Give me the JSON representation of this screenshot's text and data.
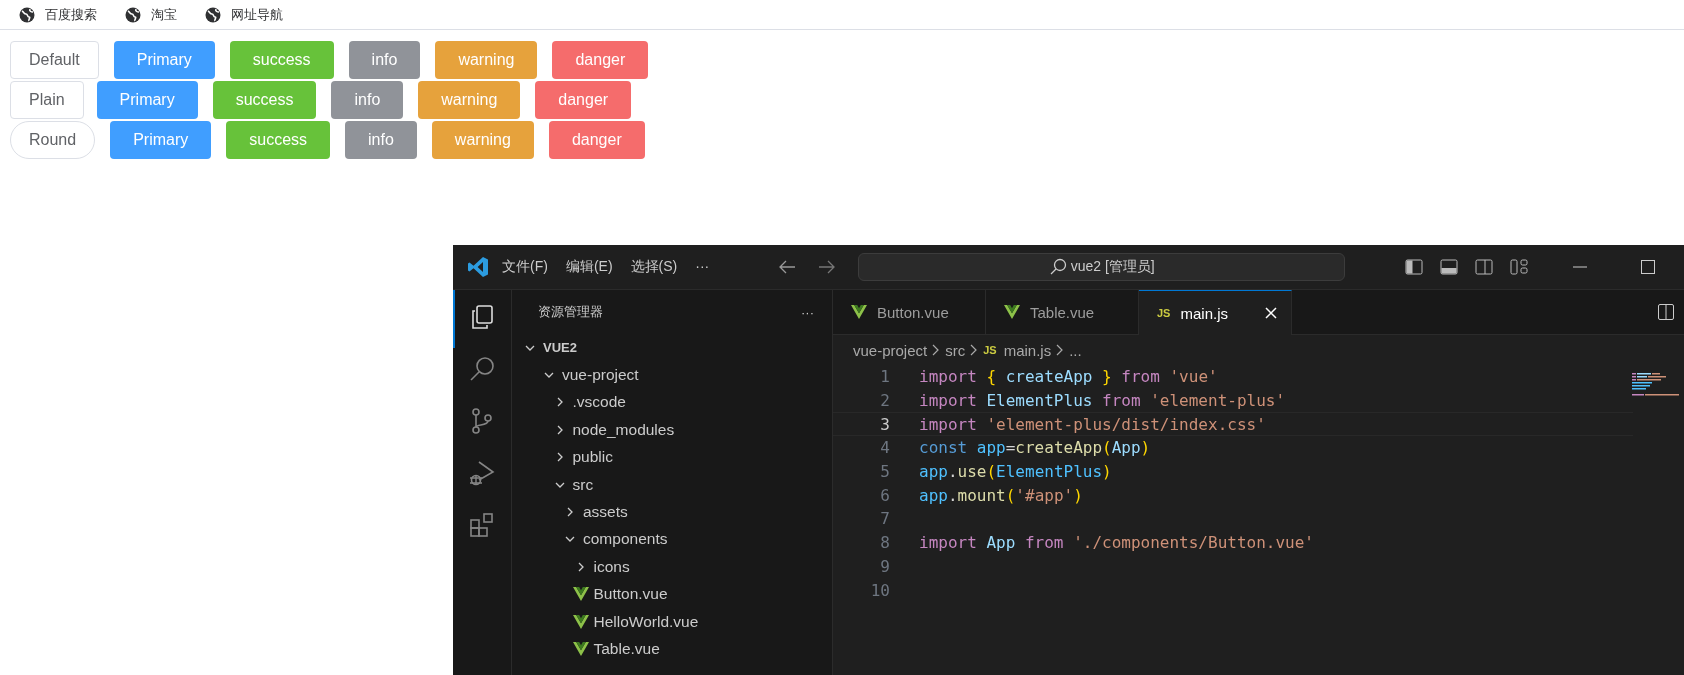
{
  "nav_links": [
    {
      "label": "百度搜索"
    },
    {
      "label": "淘宝"
    },
    {
      "label": "网址导航"
    }
  ],
  "button_rows": [
    {
      "buttons": [
        {
          "label": "Default",
          "kind": "default",
          "round": false
        },
        {
          "label": "Primary",
          "kind": "primary",
          "round": false
        },
        {
          "label": "success",
          "kind": "success",
          "round": false
        },
        {
          "label": "info",
          "kind": "info",
          "round": false
        },
        {
          "label": "warning",
          "kind": "warning",
          "round": false
        },
        {
          "label": "danger",
          "kind": "danger",
          "round": false
        }
      ]
    },
    {
      "buttons": [
        {
          "label": "Plain",
          "kind": "default",
          "round": false
        },
        {
          "label": "Primary",
          "kind": "primary",
          "round": false
        },
        {
          "label": "success",
          "kind": "success",
          "round": false
        },
        {
          "label": "info",
          "kind": "info",
          "round": false
        },
        {
          "label": "warning",
          "kind": "warning",
          "round": false
        },
        {
          "label": "danger",
          "kind": "danger",
          "round": false
        }
      ]
    },
    {
      "buttons": [
        {
          "label": "Round",
          "kind": "default",
          "round": true
        },
        {
          "label": "Primary",
          "kind": "primary",
          "round": false
        },
        {
          "label": "success",
          "kind": "success",
          "round": false
        },
        {
          "label": "info",
          "kind": "info",
          "round": false
        },
        {
          "label": "warning",
          "kind": "warning",
          "round": false
        },
        {
          "label": "danger",
          "kind": "danger",
          "round": false
        }
      ]
    }
  ],
  "vscode": {
    "menu": [
      {
        "label": "文件(F)"
      },
      {
        "label": "编辑(E)"
      },
      {
        "label": "选择(S)"
      },
      {
        "label": "···"
      }
    ],
    "search": "vue2 [管理员]",
    "sidebar": {
      "title": "资源管理器",
      "more": "···"
    },
    "tree": {
      "label": "VUE2",
      "kind": "workspace",
      "expanded": true,
      "children": [
        {
          "label": "vue-project",
          "kind": "folder",
          "expanded": true,
          "children": [
            {
              "label": ".vscode",
              "kind": "folder",
              "expanded": false
            },
            {
              "label": "node_modules",
              "kind": "folder",
              "expanded": false
            },
            {
              "label": "public",
              "kind": "folder",
              "expanded": false
            },
            {
              "label": "src",
              "kind": "folder",
              "expanded": true,
              "children": [
                {
                  "label": "assets",
                  "kind": "folder",
                  "expanded": false
                },
                {
                  "label": "components",
                  "kind": "folder",
                  "expanded": true,
                  "children": [
                    {
                      "label": "icons",
                      "kind": "folder",
                      "expanded": false
                    },
                    {
                      "label": "Button.vue",
                      "kind": "vue"
                    },
                    {
                      "label": "HelloWorld.vue",
                      "kind": "vue"
                    },
                    {
                      "label": "Table.vue",
                      "kind": "vue"
                    }
                  ]
                }
              ]
            }
          ]
        }
      ]
    },
    "tabs": [
      {
        "label": "Button.vue",
        "kind": "vue",
        "selected": false
      },
      {
        "label": "Table.vue",
        "kind": "vue",
        "selected": false
      },
      {
        "label": "main.js",
        "kind": "js",
        "badge": "JS",
        "selected": true
      }
    ],
    "breadcrumb": [
      {
        "label": "vue-project",
        "kind": "folder"
      },
      {
        "label": "src",
        "kind": "folder"
      },
      {
        "label": "main.js",
        "kind": "js",
        "badge": "JS"
      },
      {
        "label": "...",
        "kind": "more"
      }
    ],
    "code": [
      {
        "number": "1",
        "active": false,
        "tokens": [
          {
            "text": "import ",
            "kind": "control"
          },
          {
            "text": "{",
            "kind": "bracket"
          },
          {
            "text": " createApp ",
            "kind": "variable"
          },
          {
            "text": "}",
            "kind": "bracket"
          },
          {
            "text": " from ",
            "kind": "control"
          },
          {
            "text": "'vue'",
            "kind": "string"
          }
        ]
      },
      {
        "number": "2",
        "active": false,
        "tokens": [
          {
            "text": "import ",
            "kind": "control"
          },
          {
            "text": "ElementPlus ",
            "kind": "variable"
          },
          {
            "text": "from ",
            "kind": "control"
          },
          {
            "text": "'element-plus'",
            "kind": "string"
          }
        ]
      },
      {
        "number": "3",
        "active": true,
        "tokens": [
          {
            "text": "import ",
            "kind": "control"
          },
          {
            "text": "'element-plus/dist/index.css'",
            "kind": "string"
          }
        ]
      },
      {
        "number": "4",
        "active": false,
        "tokens": [
          {
            "text": "const ",
            "kind": "storage"
          },
          {
            "text": "app",
            "kind": "constant"
          },
          {
            "text": "=",
            "kind": "plain"
          },
          {
            "text": "createApp",
            "kind": "function"
          },
          {
            "text": "(",
            "kind": "bracket"
          },
          {
            "text": "App",
            "kind": "variable"
          },
          {
            "text": ")",
            "kind": "bracket"
          }
        ]
      },
      {
        "number": "5",
        "active": false,
        "tokens": [
          {
            "text": "app",
            "kind": "constant"
          },
          {
            "text": ".",
            "kind": "plain"
          },
          {
            "text": "use",
            "kind": "function"
          },
          {
            "text": "(",
            "kind": "bracket"
          },
          {
            "text": "ElementPlus",
            "kind": "constant"
          },
          {
            "text": ")",
            "kind": "bracket"
          }
        ]
      },
      {
        "number": "6",
        "active": false,
        "tokens": [
          {
            "text": "app",
            "kind": "constant"
          },
          {
            "text": ".",
            "kind": "plain"
          },
          {
            "text": "mount",
            "kind": "function"
          },
          {
            "text": "(",
            "kind": "bracket"
          },
          {
            "text": "'#app'",
            "kind": "string"
          },
          {
            "text": ")",
            "kind": "bracket"
          }
        ]
      },
      {
        "number": "7",
        "active": false
      },
      {
        "number": "8",
        "active": false,
        "tokens": [
          {
            "text": "import ",
            "kind": "control"
          },
          {
            "text": "App ",
            "kind": "variable"
          },
          {
            "text": "from ",
            "kind": "control"
          },
          {
            "text": "'./components/Button.vue'",
            "kind": "string"
          }
        ]
      },
      {
        "number": "9",
        "active": false
      },
      {
        "number": "10",
        "active": false
      }
    ]
  }
}
